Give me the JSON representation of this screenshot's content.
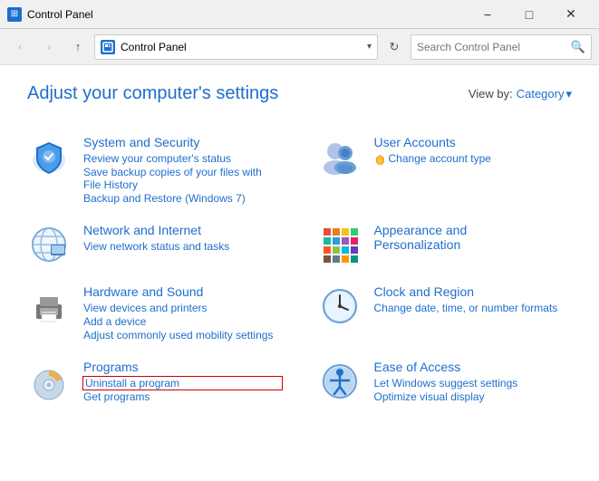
{
  "titleBar": {
    "title": "Control Panel",
    "minimizeLabel": "−",
    "maximizeLabel": "□",
    "closeLabel": "✕"
  },
  "navBar": {
    "backLabel": "‹",
    "forwardLabel": "›",
    "upLabel": "↑",
    "addressIcon": "⊞",
    "addressPath": "Control Panel",
    "dropdownLabel": "▾",
    "refreshLabel": "↻",
    "searchPlaceholder": "Search Control Panel",
    "searchIconLabel": "🔍"
  },
  "header": {
    "title": "Adjust your computer's settings",
    "viewByLabel": "View by:",
    "viewByValue": "Category",
    "viewByDropdown": "▾"
  },
  "categories": [
    {
      "id": "system-security",
      "title": "System and Security",
      "links": [
        "Review your computer's status",
        "Save backup copies of your files with File History",
        "Backup and Restore (Windows 7)"
      ],
      "highlighted": []
    },
    {
      "id": "user-accounts",
      "title": "User Accounts",
      "links": [
        "Change account type"
      ],
      "highlighted": []
    },
    {
      "id": "network-internet",
      "title": "Network and Internet",
      "links": [
        "View network status and tasks"
      ],
      "highlighted": []
    },
    {
      "id": "appearance-personalization",
      "title": "Appearance and Personalization",
      "links": [],
      "highlighted": []
    },
    {
      "id": "hardware-sound",
      "title": "Hardware and Sound",
      "links": [
        "View devices and printers",
        "Add a device",
        "Adjust commonly used mobility settings"
      ],
      "highlighted": []
    },
    {
      "id": "clock-region",
      "title": "Clock and Region",
      "links": [
        "Change date, time, or number formats"
      ],
      "highlighted": []
    },
    {
      "id": "programs",
      "title": "Programs",
      "links": [
        "Uninstall a program",
        "Get programs"
      ],
      "highlighted": [
        "Uninstall a program"
      ]
    },
    {
      "id": "ease-of-access",
      "title": "Ease of Access",
      "links": [
        "Let Windows suggest settings",
        "Optimize visual display"
      ],
      "highlighted": []
    }
  ]
}
